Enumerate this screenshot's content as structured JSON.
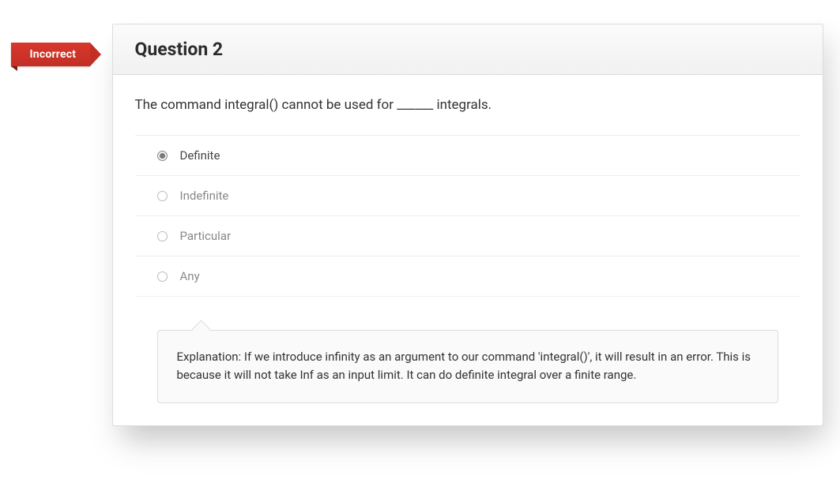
{
  "ribbon": {
    "label": "Incorrect"
  },
  "header": {
    "title": "Question 2"
  },
  "question": {
    "text": "The command integral() cannot be used for ______ integrals.",
    "options": [
      {
        "label": "Definite",
        "selected": true
      },
      {
        "label": "Indefinite",
        "selected": false
      },
      {
        "label": "Particular",
        "selected": false
      },
      {
        "label": "Any",
        "selected": false
      }
    ],
    "explanation": "Explanation: If we introduce infinity as an argument to our command 'integral()', it will result in an error. This is because it will not take Inf as an input limit. It can do definite integral over a finite range."
  }
}
